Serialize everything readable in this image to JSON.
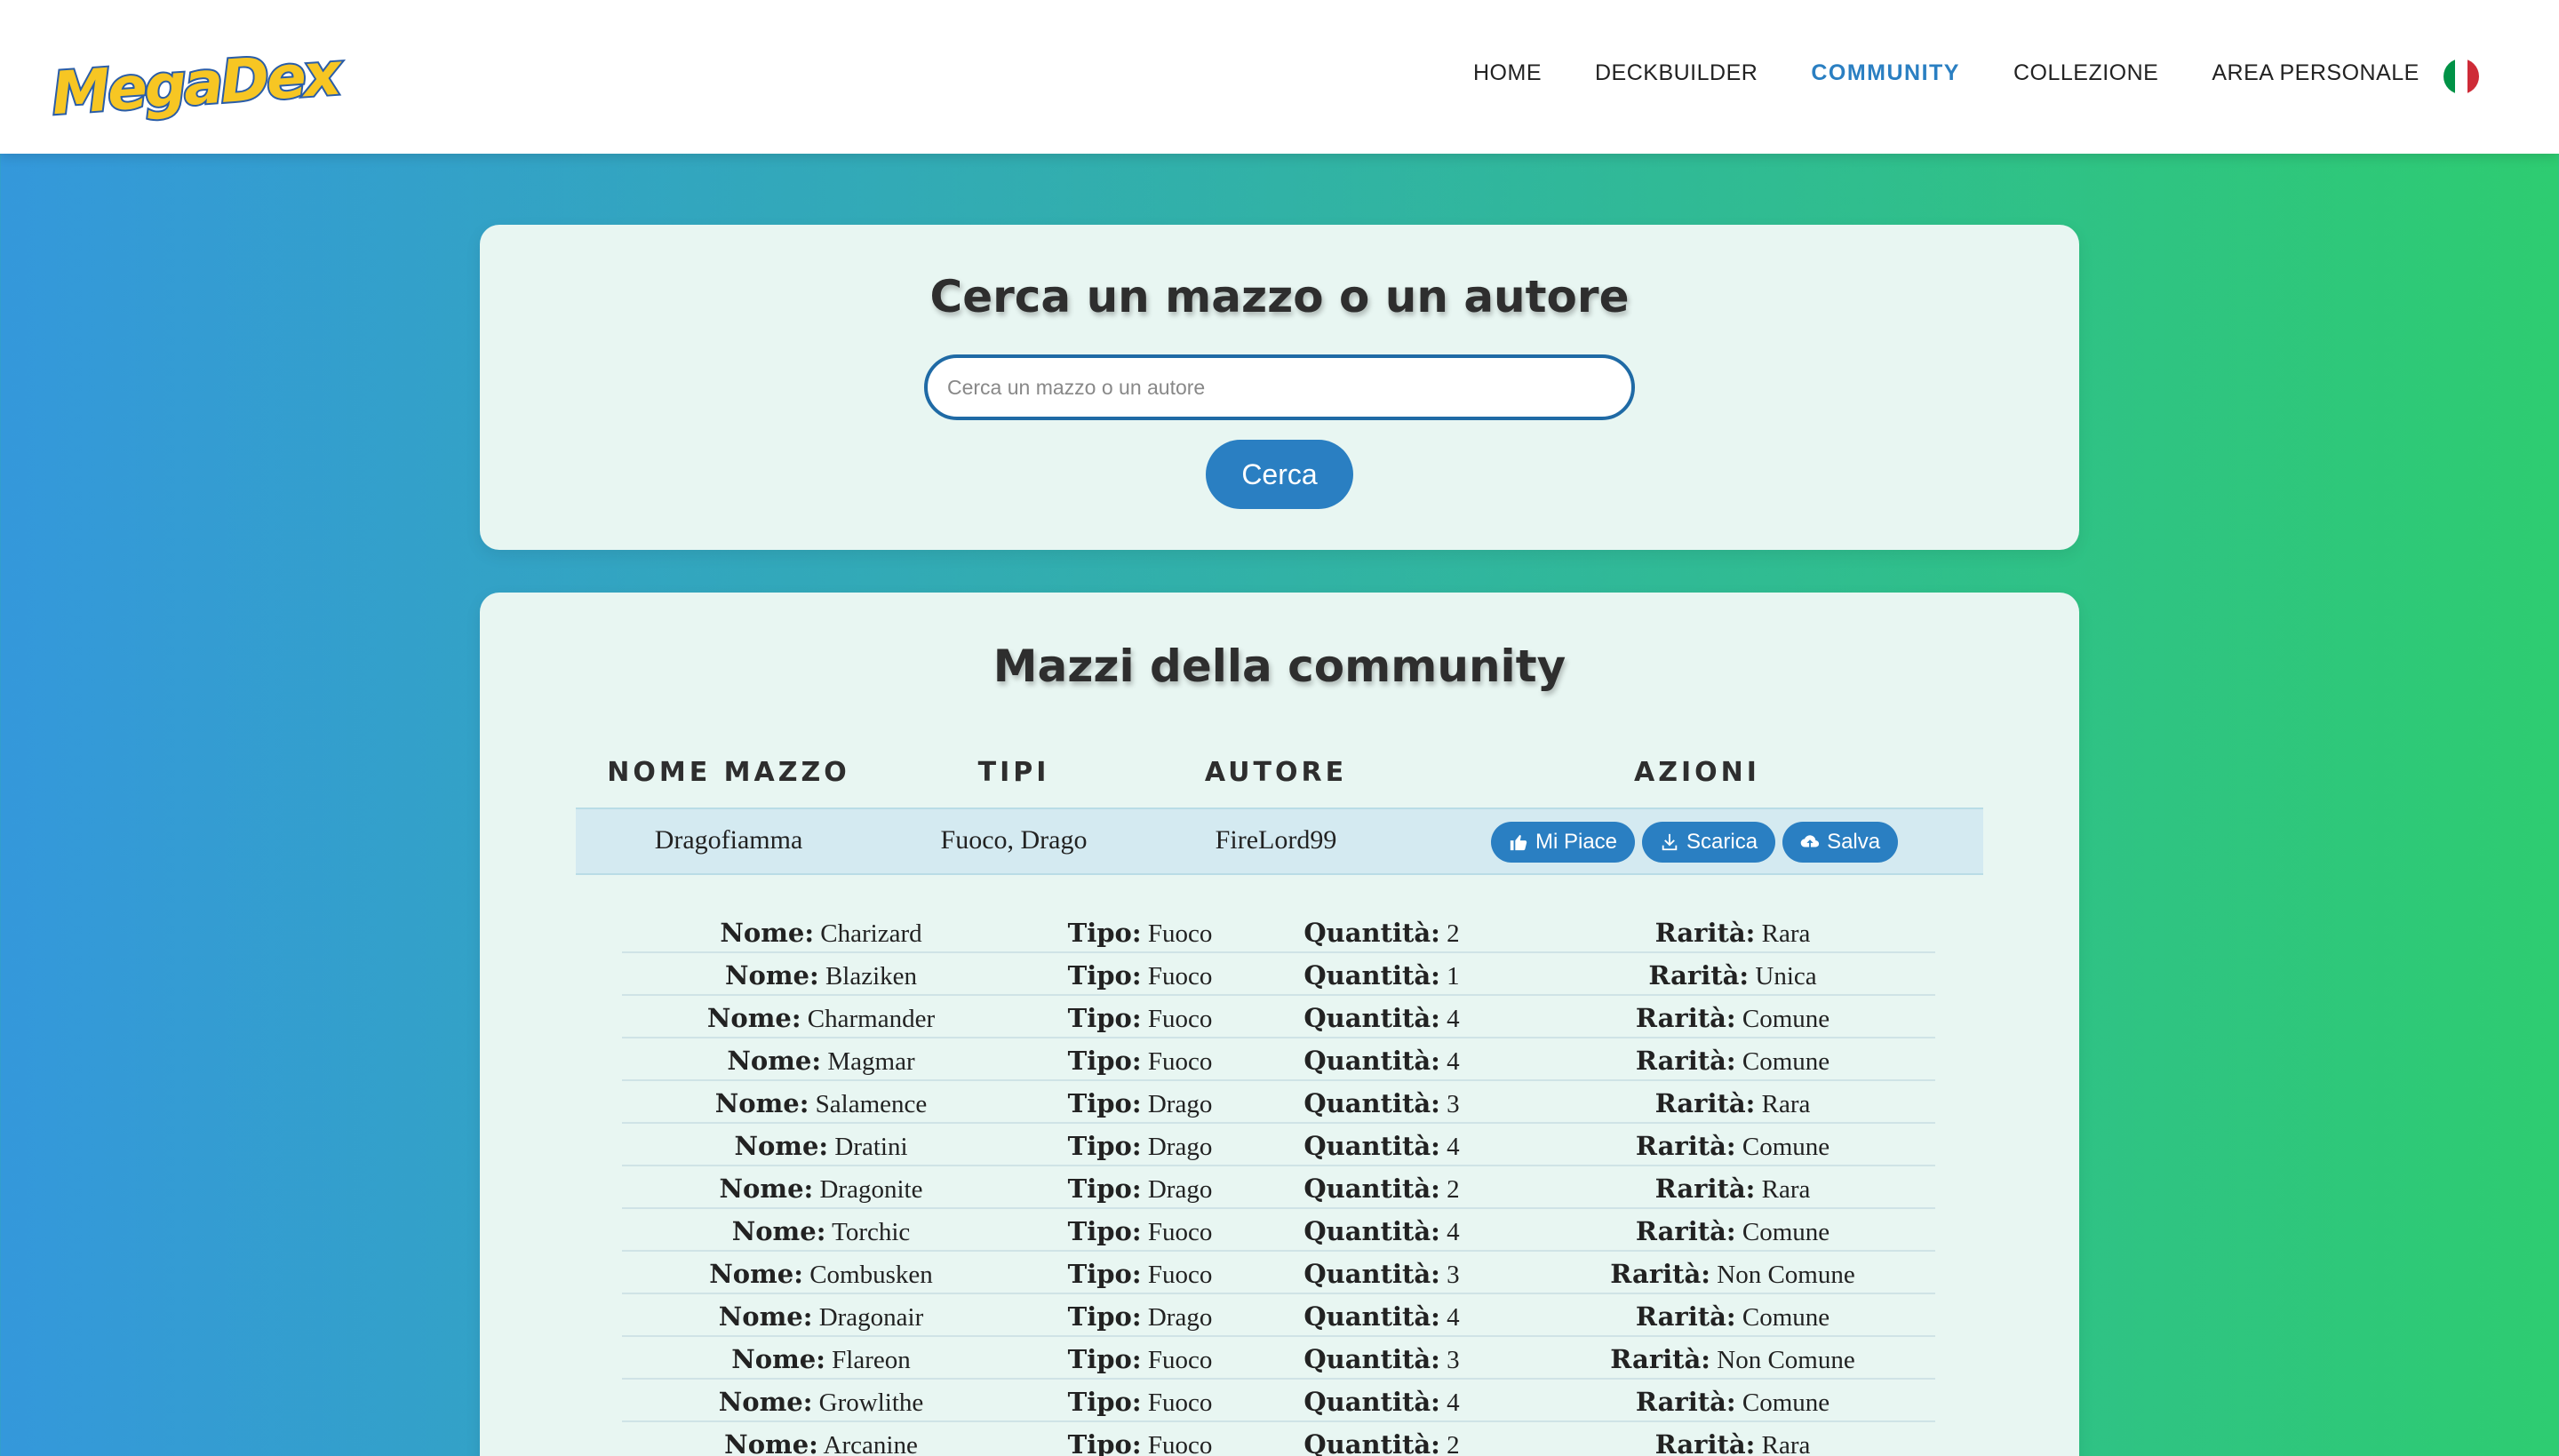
{
  "brand": {
    "logo_text": "MegaDex"
  },
  "nav": {
    "items": [
      {
        "label": "HOME",
        "active": false
      },
      {
        "label": "DECKBUILDER",
        "active": false
      },
      {
        "label": "COMMUNITY",
        "active": true
      },
      {
        "label": "COLLEZIONE",
        "active": false
      },
      {
        "label": "AREA PERSONALE",
        "active": false
      }
    ],
    "language_flag": "italian-flag-icon"
  },
  "search": {
    "title": "Cerca un mazzo o un autore",
    "placeholder": "Cerca un mazzo o un autore",
    "value": "",
    "button_label": "Cerca"
  },
  "community": {
    "title": "Mazzi della community",
    "columns": [
      "NOME MAZZO",
      "TIPI",
      "AUTORE",
      "AZIONI"
    ],
    "deck": {
      "name": "Dragofiamma",
      "types": "Fuoco, Drago",
      "author": "FireLord99",
      "actions": [
        {
          "label": "Mi Piace",
          "icon": "thumbs-up-icon"
        },
        {
          "label": "Scarica",
          "icon": "download-icon"
        },
        {
          "label": "Salva",
          "icon": "cloud-upload-icon"
        }
      ]
    },
    "card_labels": {
      "name": "Nome:",
      "type": "Tipo:",
      "quantity": "Quantità:",
      "rarity": "Rarità:"
    },
    "cards": [
      {
        "name": "Charizard",
        "type": "Fuoco",
        "quantity": "2",
        "rarity": "Rara"
      },
      {
        "name": "Blaziken",
        "type": "Fuoco",
        "quantity": "1",
        "rarity": "Unica"
      },
      {
        "name": "Charmander",
        "type": "Fuoco",
        "quantity": "4",
        "rarity": "Comune"
      },
      {
        "name": "Magmar",
        "type": "Fuoco",
        "quantity": "4",
        "rarity": "Comune"
      },
      {
        "name": "Salamence",
        "type": "Drago",
        "quantity": "3",
        "rarity": "Rara"
      },
      {
        "name": "Dratini",
        "type": "Drago",
        "quantity": "4",
        "rarity": "Comune"
      },
      {
        "name": "Dragonite",
        "type": "Drago",
        "quantity": "2",
        "rarity": "Rara"
      },
      {
        "name": "Torchic",
        "type": "Fuoco",
        "quantity": "4",
        "rarity": "Comune"
      },
      {
        "name": "Combusken",
        "type": "Fuoco",
        "quantity": "3",
        "rarity": "Non Comune"
      },
      {
        "name": "Dragonair",
        "type": "Drago",
        "quantity": "4",
        "rarity": "Comune"
      },
      {
        "name": "Flareon",
        "type": "Fuoco",
        "quantity": "3",
        "rarity": "Non Comune"
      },
      {
        "name": "Growlithe",
        "type": "Fuoco",
        "quantity": "4",
        "rarity": "Comune"
      },
      {
        "name": "Arcanine",
        "type": "Fuoco",
        "quantity": "2",
        "rarity": "Rara"
      }
    ]
  }
}
